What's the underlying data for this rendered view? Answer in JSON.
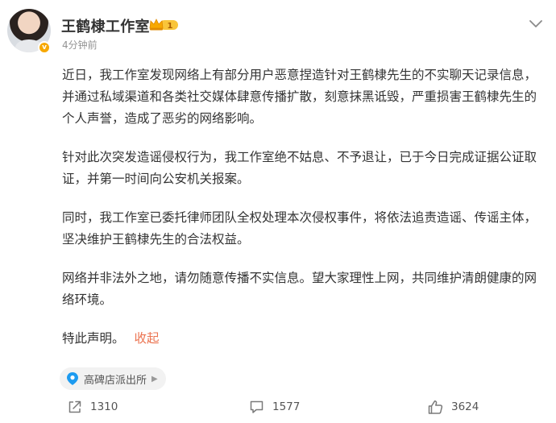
{
  "author": {
    "name": "王鹤棣工作室",
    "vip_level": "1",
    "time": "4分钟前"
  },
  "post": {
    "paragraphs": [
      "近日，我工作室发现网络上有部分用户恶意捏造针对王鹤棣先生的不实聊天记录信息，并通过私域渠道和各类社交媒体肆意传播扩散，刻意抹黑诋毁，严重损害王鹤棣先生的个人声誉，造成了恶劣的网络影响。",
      "针对此次突发造谣侵权行为，我工作室绝不姑息、不予退让，已于今日完成证据公证取证，并第一时间向公安机关报案。",
      "同时，我工作室已委托律师团队全权处理本次侵权事件，将依法追责造谣、传谣主体，坚决维护王鹤棣先生的合法权益。",
      "网络并非法外之地，请勿随意传播不实信息。望大家理性上网，共同维护清朗健康的网络环境。"
    ],
    "closing": "特此声明。",
    "collapse_label": "收起"
  },
  "location": {
    "label": "高碑店派出所",
    "icon": "location-pin-icon"
  },
  "actions": {
    "share_count": "1310",
    "comment_count": "1577",
    "like_count": "3624"
  },
  "colors": {
    "accent": "#eb7350",
    "location_pin": "#1d9bf0",
    "vip_gold": "#f7a800"
  }
}
